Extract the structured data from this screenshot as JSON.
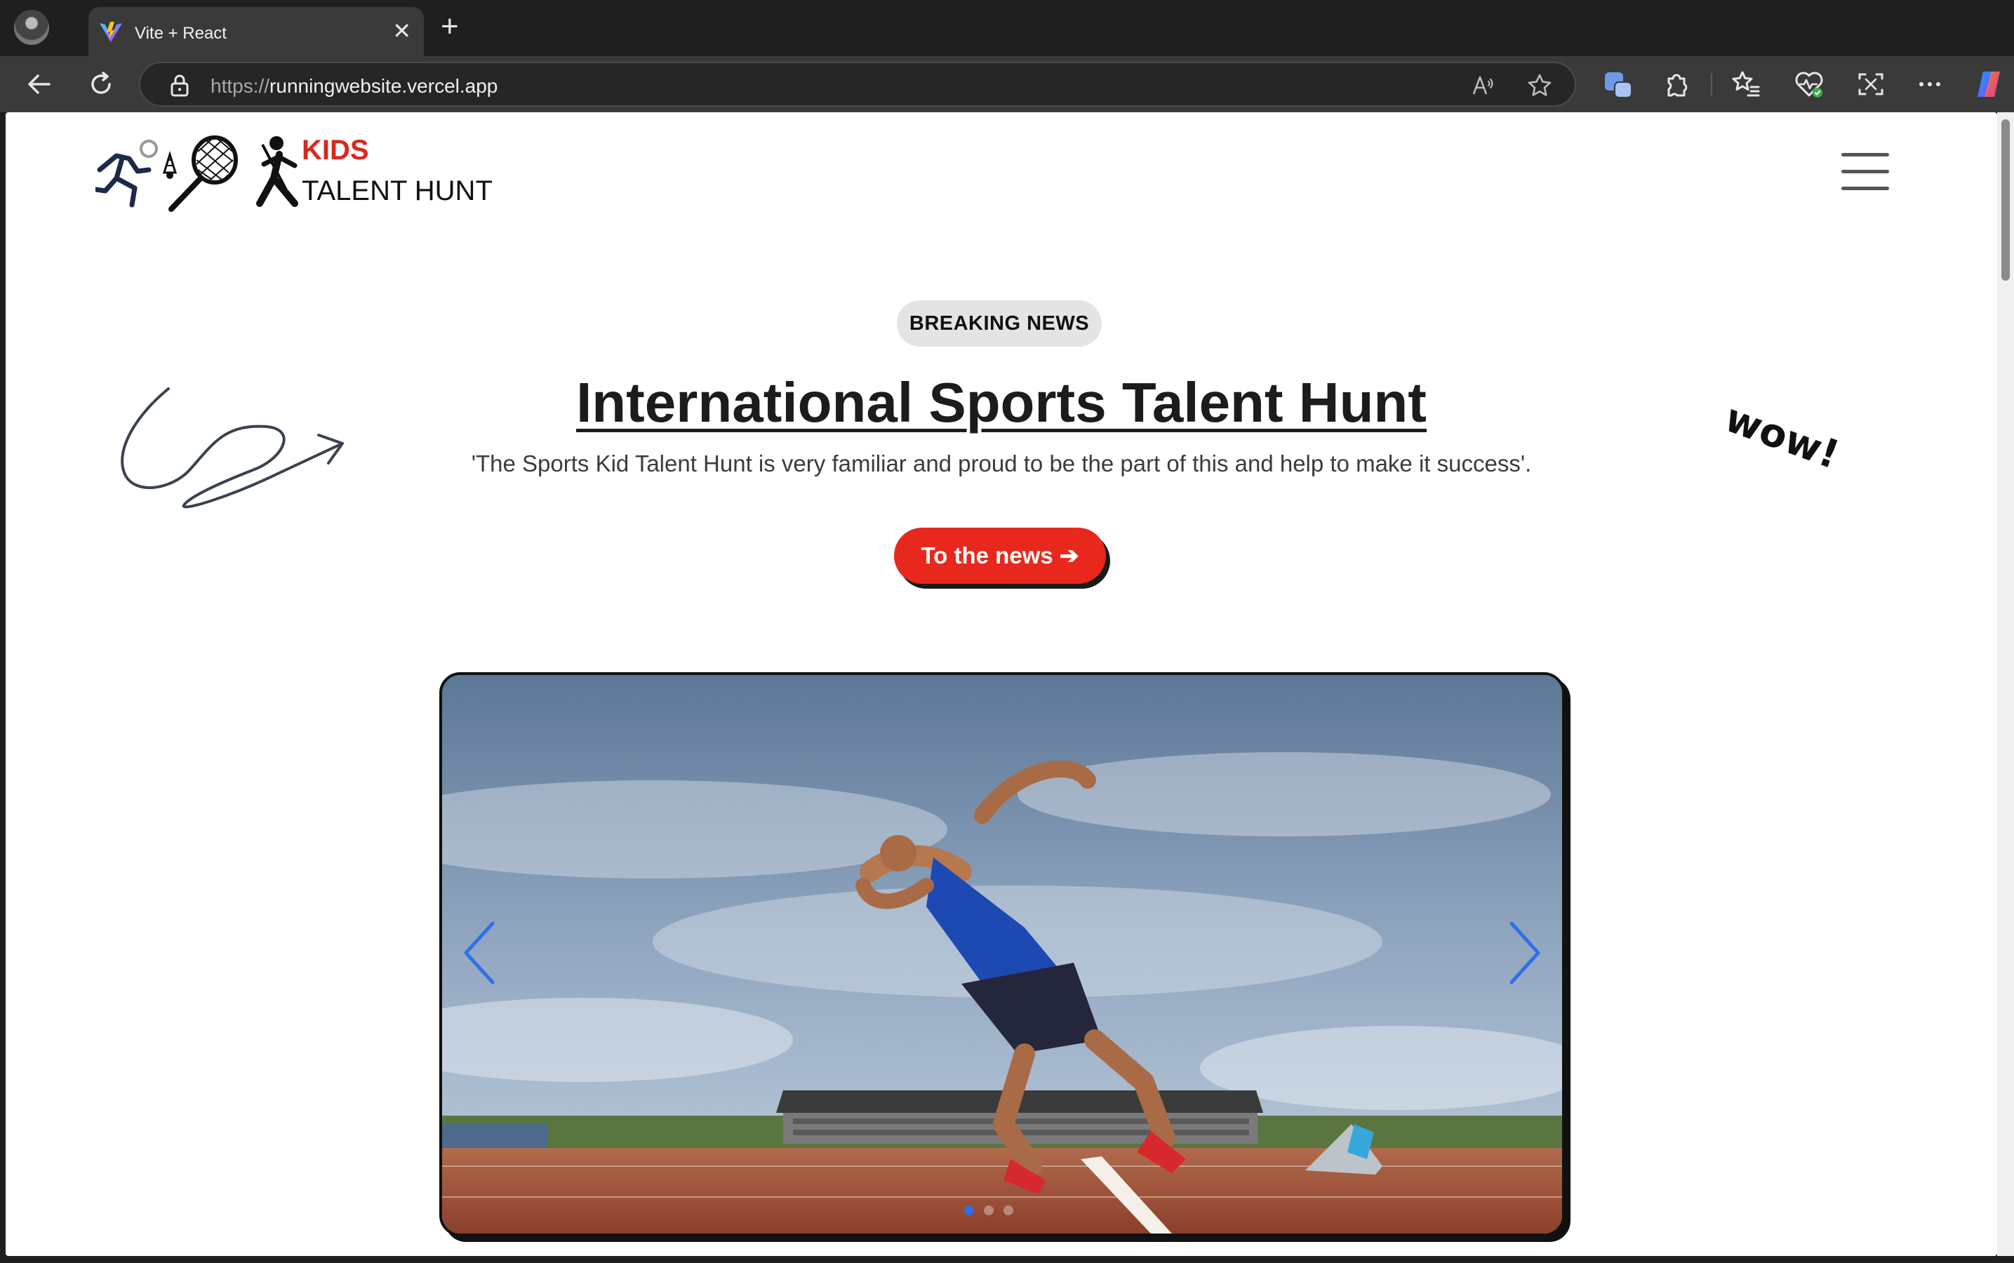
{
  "browser": {
    "tab_title": "Vite + React",
    "url_scheme": "https://",
    "url_host": "runningwebsite.vercel.app"
  },
  "site": {
    "logo_kids": "KIDS",
    "logo_talent": "TALENT HUNT"
  },
  "hero": {
    "badge": "BREAKING NEWS",
    "headline": "International Sports Talent Hunt",
    "subtitle": "'The Sports Kid Talent Hunt is very familiar and proud to be the part of this and help to make it success'.",
    "cta_label": "To the news ➔",
    "doodle_text": "wow!"
  },
  "carousel": {
    "slide_count": 3,
    "active_slide": 1,
    "arrow_color": "#2f6fe8",
    "active_dot_color": "#2f6fe8"
  },
  "colors": {
    "accent_red": "#e8281c",
    "logo_red": "#d9281e"
  }
}
